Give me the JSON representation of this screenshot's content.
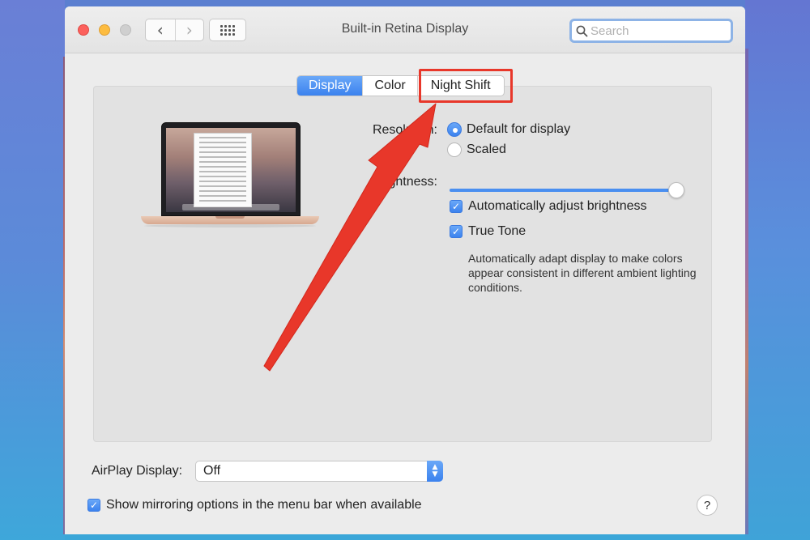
{
  "window": {
    "title": "Built-in Retina Display"
  },
  "toolbar": {
    "back_icon": "chevron-left-icon",
    "back_glyph": "‹",
    "forward_icon": "chevron-right-icon",
    "forward_glyph": "›",
    "grid_icon": "show-all-grid-icon"
  },
  "search": {
    "placeholder": "Search",
    "icon": "search-icon"
  },
  "tabs": [
    {
      "label": "Display",
      "active": true
    },
    {
      "label": "Color",
      "active": false
    },
    {
      "label": "Night Shift",
      "active": false
    }
  ],
  "display": {
    "resolution_label": "Resolution:",
    "resolution_options": [
      {
        "label": "Default for display",
        "selected": true
      },
      {
        "label": "Scaled",
        "selected": false
      }
    ],
    "brightness_label": "Brightness:",
    "brightness_level": 1.0,
    "auto_brightness_label": "Automatically adjust brightness",
    "auto_brightness_checked": true,
    "true_tone_label": "True Tone",
    "true_tone_checked": true,
    "true_tone_description": "Automatically adapt display to make colors appear consistent in different ambient lighting conditions."
  },
  "airplay": {
    "label": "AirPlay Display:",
    "value": "Off"
  },
  "mirroring": {
    "label": "Show mirroring options in the menu bar when available",
    "checked": true
  },
  "help": {
    "label": "?"
  },
  "annotation": {
    "highlight_color": "#e8372a",
    "arrow_color": "#e8372a"
  },
  "colors": {
    "accent": "#3b82ee",
    "window_bg": "#ececec"
  }
}
